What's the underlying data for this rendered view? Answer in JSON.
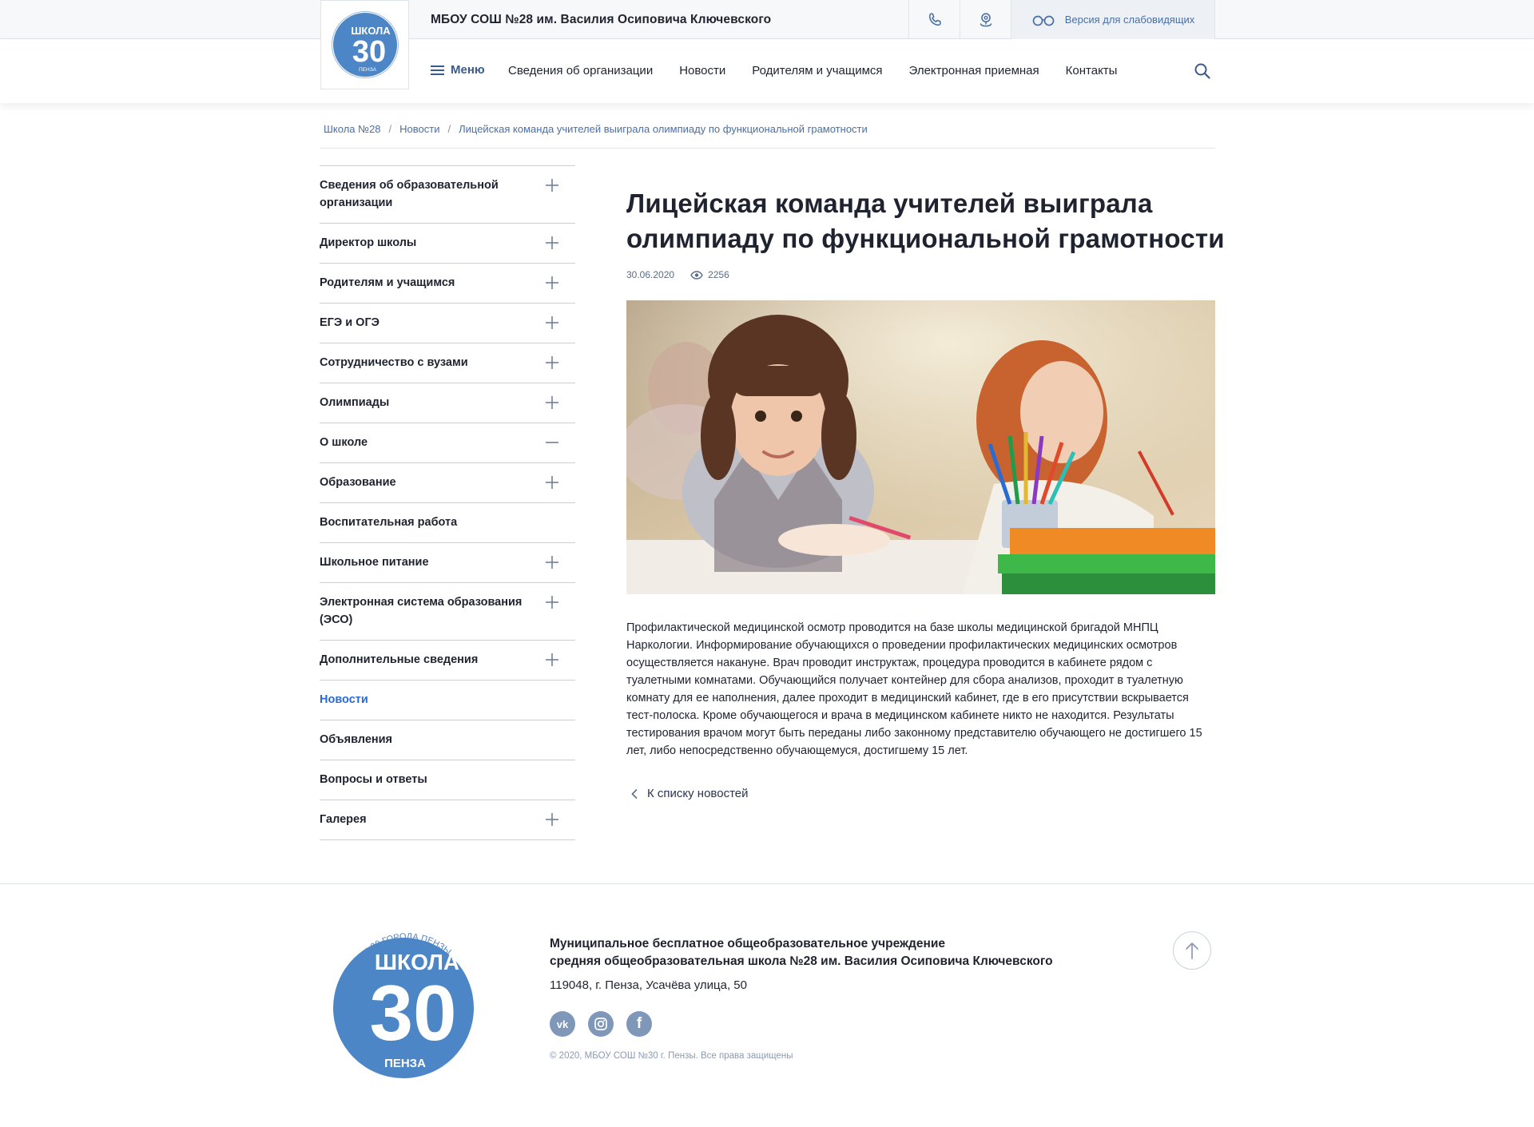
{
  "header": {
    "logo_top": "ШКОЛА",
    "logo_number": "30",
    "logo_bottom": "ПЕНЗА",
    "site_title": "МБОУ СОШ №28 им. Василия Осиповича Ключевского",
    "low_vision_label": "Версия для слабовидящих",
    "menu_label": "Меню",
    "nav": [
      {
        "label": "Сведения об организации"
      },
      {
        "label": "Новости"
      },
      {
        "label": "Родителям и учащимся"
      },
      {
        "label": "Электронная приемная"
      },
      {
        "label": "Контакты"
      }
    ]
  },
  "breadcrumb": [
    "Школа №28",
    "Новости",
    "Лицейская команда учителей выиграла олимпиаду по функциональной грамотности"
  ],
  "sidebar": {
    "items": [
      {
        "label": "Сведения об образовательной организации",
        "toggle": "plus"
      },
      {
        "label": "Директор школы",
        "toggle": "plus"
      },
      {
        "label": "Родителям и учащимся",
        "toggle": "plus"
      },
      {
        "label": "ЕГЭ и ОГЭ",
        "toggle": "plus"
      },
      {
        "label": "Сотрудничество с вузами",
        "toggle": "plus"
      },
      {
        "label": "Олимпиады",
        "toggle": "plus"
      },
      {
        "label": "О школе",
        "toggle": "minus"
      },
      {
        "label": "Образование",
        "toggle": "plus"
      },
      {
        "label": "Воспитательная работа",
        "toggle": ""
      },
      {
        "label": "Школьное питание",
        "toggle": "plus"
      },
      {
        "label": "Электронная система образования (ЭСО)",
        "toggle": "plus"
      },
      {
        "label": "Дополнительные сведения",
        "toggle": "plus"
      },
      {
        "label": "Новости",
        "toggle": "",
        "active": true
      },
      {
        "label": "Объявления",
        "toggle": ""
      },
      {
        "label": "Вопросы и ответы",
        "toggle": ""
      },
      {
        "label": "Галерея",
        "toggle": "plus"
      }
    ]
  },
  "article": {
    "title": "Лицейская команда учителей выиграла олимпиаду по функциональной грамотности",
    "date": "30.06.2020",
    "views": "2256",
    "body": "Профилактической медицинской осмотр проводится на базе школы медицинской бригадой МНПЦ Наркологии. Информирование обучающихся о проведении профилактических медицинских осмотров осуществляется накануне. Врач проводит инструктаж, процедура проводится в кабинете рядом с туалетными комнатами. Обучающийся получает контейнер для сбора анализов, проходит в туалетную комнату для ее наполнения, далее проходит в медицинский кабинет, где в его присутствии вскрывается тест-полоска. Кроме обучающегося и врача в медицинском кабинете никто не находится. Результаты тестирования врачом могут быть переданы либо законному представителю обучающего не достигшего 15 лет, либо непосредственно обучающемуся, достигшему 15 лет.",
    "back_label": "К списку новостей"
  },
  "footer": {
    "logo_arc": "МБОУ СОШ №30 ГОРОДА ПЕНЗЫ",
    "logo_top": "ШКОЛА",
    "logo_number": "30",
    "logo_bottom": "ПЕНЗА",
    "org_line1": "Муниципальное бесплатное общеобразовательное учреждение",
    "org_line2": "средняя общеобразовательная школа №28 им. Василия Осиповича Ключевского",
    "address": "119048, г. Пенза, Усачёва улица, 50",
    "socials": [
      {
        "name": "vk-icon",
        "glyph": "vk"
      },
      {
        "name": "instagram-icon",
        "glyph": ""
      },
      {
        "name": "facebook-icon",
        "glyph": "f"
      }
    ],
    "copyright": "© 2020, МБОУ СОШ №30 г. Пензы. Все права защищены"
  },
  "colors": {
    "accent": "#2a6bd1",
    "logo_blue": "#4d86c6",
    "social_bg": "#7f97b8"
  },
  "icons": [
    "phone-icon",
    "location-icon",
    "glasses-icon",
    "menu-icon",
    "search-icon",
    "eye-icon",
    "plus-icon",
    "minus-icon",
    "chevron-left-icon",
    "arrow-up-icon"
  ]
}
